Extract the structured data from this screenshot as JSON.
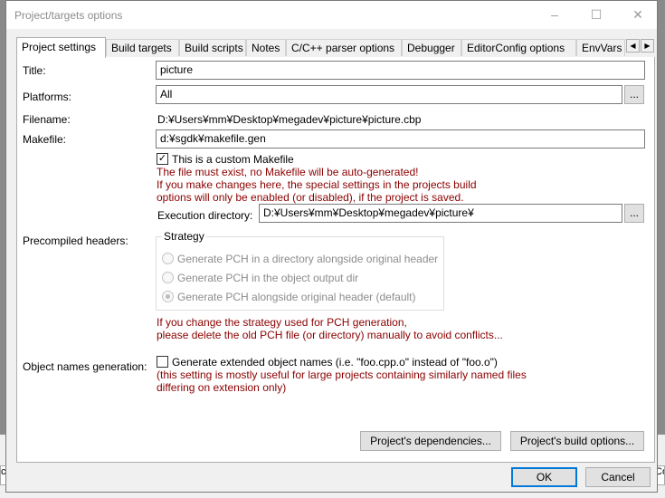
{
  "window": {
    "title": "Project/targets options",
    "minimize": "–",
    "maximize": "☐",
    "close": "✕"
  },
  "tabs": [
    {
      "label": "Project settings",
      "active": true
    },
    {
      "label": "Build targets"
    },
    {
      "label": "Build scripts"
    },
    {
      "label": "Notes"
    },
    {
      "label": "C/C++ parser options"
    },
    {
      "label": "Debugger"
    },
    {
      "label": "EditorConfig options"
    },
    {
      "label": "EnvVars"
    }
  ],
  "tab_scroll": {
    "left": "◀",
    "right": "▶"
  },
  "fields": {
    "title_label": "Title:",
    "title_value": "picture",
    "platforms_label": "Platforms:",
    "platforms_value": "All",
    "filename_label": "Filename:",
    "filename_value": "D:¥Users¥mm¥Desktop¥megadev¥picture¥picture.cbp",
    "makefile_label": "Makefile:",
    "makefile_value": "d:¥sgdk¥makefile.gen",
    "custom_makefile_label": "This is a custom Makefile",
    "custom_makefile_checked": true,
    "check_mark": "✓",
    "browse_label": "...",
    "makefile_warning_1": "The file must exist, no Makefile will be auto-generated!",
    "makefile_warning_2": "If you make changes here, the special settings in the projects build",
    "makefile_warning_3": "options will only be enabled (or disabled), if the project is saved.",
    "exec_dir_label": "Execution directory:",
    "exec_dir_value": "D:¥Users¥mm¥Desktop¥megadev¥picture¥"
  },
  "pch": {
    "label": "Precompiled headers:",
    "group_label": "Strategy",
    "options": [
      {
        "label": "Generate PCH in a directory alongside original header",
        "selected": false
      },
      {
        "label": "Generate PCH in the object output dir",
        "selected": false
      },
      {
        "label": "Generate PCH alongside original header (default)",
        "selected": true
      }
    ],
    "warning_1": "If you change the strategy used for PCH generation,",
    "warning_2": "please delete the old PCH file (or directory) manually to avoid conflicts..."
  },
  "objnames": {
    "label": "Object names generation:",
    "checkbox_label": "Generate extended object names (i.e. \"foo.cpp.o\" instead of \"foo.o\")",
    "checked": false,
    "note_1": "(this setting is mostly useful for large projects containing similarly named files",
    "note_2": "differing on extension only)"
  },
  "buttons": {
    "dependencies": "Project's dependencies...",
    "build_options": "Project's build options...",
    "ok": "OK",
    "cancel": "Cancel"
  },
  "background": {
    "left_fragment": "co",
    "right_fragment": "Co"
  }
}
